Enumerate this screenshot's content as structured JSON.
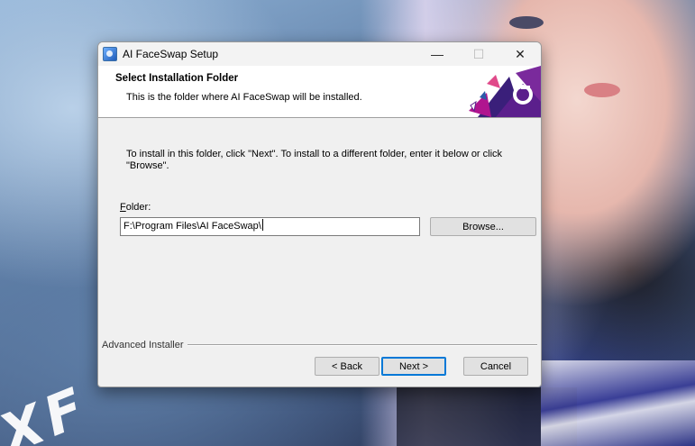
{
  "window": {
    "title": "AI FaceSwap Setup",
    "minimize_glyph": "—",
    "maximize_glyph": "☐",
    "close_glyph": "✕"
  },
  "header": {
    "title": "Select Installation Folder",
    "subtitle": "This is the folder where AI FaceSwap will be installed."
  },
  "body": {
    "instructions": "To install in this folder, click \"Next\". To install to a different folder, enter it below or click \"Browse\"."
  },
  "folder": {
    "label_accel": "F",
    "label_rest": "older:",
    "value": "F:\\Program Files\\AI FaceSwap\\"
  },
  "buttons": {
    "browse": "Browse...",
    "back": "< Back",
    "next": "Next >",
    "cancel": "Cancel"
  },
  "branding": {
    "text": "Advanced Installer"
  },
  "background": {
    "watermark": "XF"
  },
  "colors": {
    "accent": "#0078d7",
    "logo_purple": "#5b1f8c",
    "logo_magenta": "#b0158f"
  }
}
